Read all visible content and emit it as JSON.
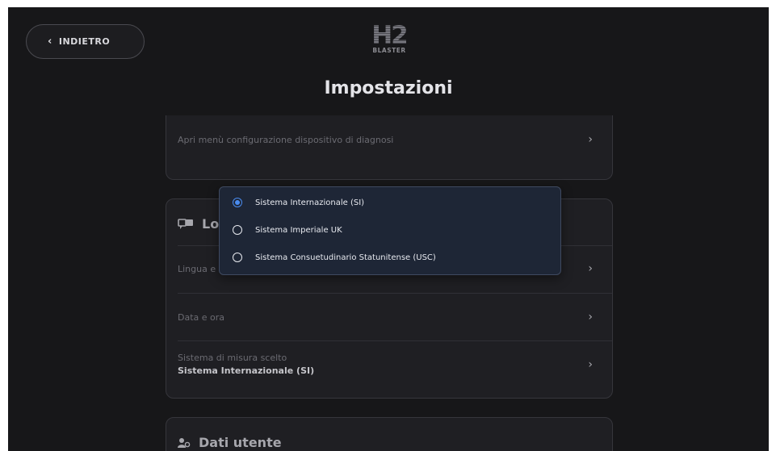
{
  "header": {
    "back_label": "INDIETRO",
    "logo_main": "H2",
    "logo_sub": "BLASTER",
    "title": "Impostazioni"
  },
  "device_card": {
    "row_label": "Apri menù configurazione dispositivo di diagnosi"
  },
  "language_card": {
    "heading": "Lo",
    "rows": [
      {
        "label": "Lingua e"
      },
      {
        "label": "Data e ora"
      },
      {
        "label": "Sistema di misura scelto",
        "value": "Sistema Internazionale (SI)"
      }
    ]
  },
  "user_card": {
    "heading": "Dati utente"
  },
  "measure_popup": {
    "options": [
      {
        "label": "Sistema Internazionale (SI)",
        "selected": true
      },
      {
        "label": "Sistema Imperiale UK",
        "selected": false
      },
      {
        "label": "Sistema Consuetudinario Statunitense (USC)",
        "selected": false
      }
    ]
  },
  "colors": {
    "background": "#171719",
    "card": "#1f1f23",
    "popup": "#1e2636",
    "accent": "#4a8cf0"
  },
  "icons": {
    "back": "chevron-left-icon",
    "row": "chevron-right-icon",
    "language": "language-chat-icon",
    "user": "user-settings-icon"
  }
}
